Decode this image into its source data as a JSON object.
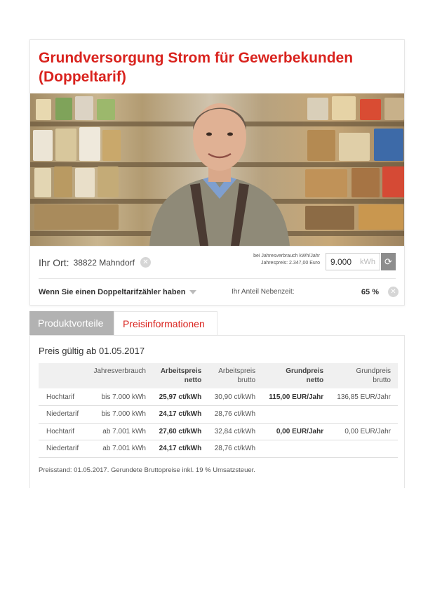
{
  "title": "Grundversorgung Strom für Gewerbekunden (Doppeltarif)",
  "location": {
    "label": "Ihr Ort:",
    "value": "38822 Mahndorf",
    "usage_hint_line1": "bei Jahresverbrauch kWh/Jahr",
    "usage_hint_line2": "Jahrespreis: 2.347,00 Euro",
    "kwh_value": "9.000",
    "kwh_unit": "kWh"
  },
  "option": {
    "label": "Wenn Sie einen Doppeltarifzähler haben",
    "share_label": "Ihr Anteil Nebenzeit:",
    "share_value": "65 %"
  },
  "tabs": [
    {
      "label": "Produktvorteile"
    },
    {
      "label": "Preisinformationen"
    }
  ],
  "panel": {
    "valid_from": "Preis gültig ab 01.05.2017",
    "headers": {
      "col1": "",
      "col2": "Jahresverbrauch",
      "col3a": "Arbeitspreis",
      "col3b": "netto",
      "col4a": "Arbeitspreis",
      "col4b": "brutto",
      "col5a": "Grundpreis",
      "col5b": "netto",
      "col6a": "Grundpreis",
      "col6b": "brutto"
    },
    "rows": [
      {
        "tarif": "Hochtarif",
        "verbrauch": "bis 7.000 kWh",
        "ap_netto": "25,97 ct/kWh",
        "ap_brutto": "30,90 ct/kWh",
        "gp_netto": "115,00 EUR/Jahr",
        "gp_brutto": "136,85 EUR/Jahr"
      },
      {
        "tarif": "Niedertarif",
        "verbrauch": "bis 7.000 kWh",
        "ap_netto": "24,17 ct/kWh",
        "ap_brutto": "28,76 ct/kWh",
        "gp_netto": "",
        "gp_brutto": ""
      },
      {
        "tarif": "Hochtarif",
        "verbrauch": "ab 7.001 kWh",
        "ap_netto": "27,60 ct/kWh",
        "ap_brutto": "32,84 ct/kWh",
        "gp_netto": "0,00 EUR/Jahr",
        "gp_brutto": "0,00 EUR/Jahr"
      },
      {
        "tarif": "Niedertarif",
        "verbrauch": "ab 7.001 kWh",
        "ap_netto": "24,17 ct/kWh",
        "ap_brutto": "28,76 ct/kWh",
        "gp_netto": "",
        "gp_brutto": ""
      }
    ],
    "note": "Preisstand: 01.05.2017. Gerundete Bruttopreise inkl. 19 % Umsatzsteuer."
  },
  "colors": {
    "accent": "#d9231e",
    "tab_inactive": "#b2b2b2",
    "refresh_button": "#8d8d8d"
  },
  "icons": {
    "clear": "close-icon",
    "refresh": "refresh-icon",
    "dropdown": "chevron-down-icon"
  }
}
